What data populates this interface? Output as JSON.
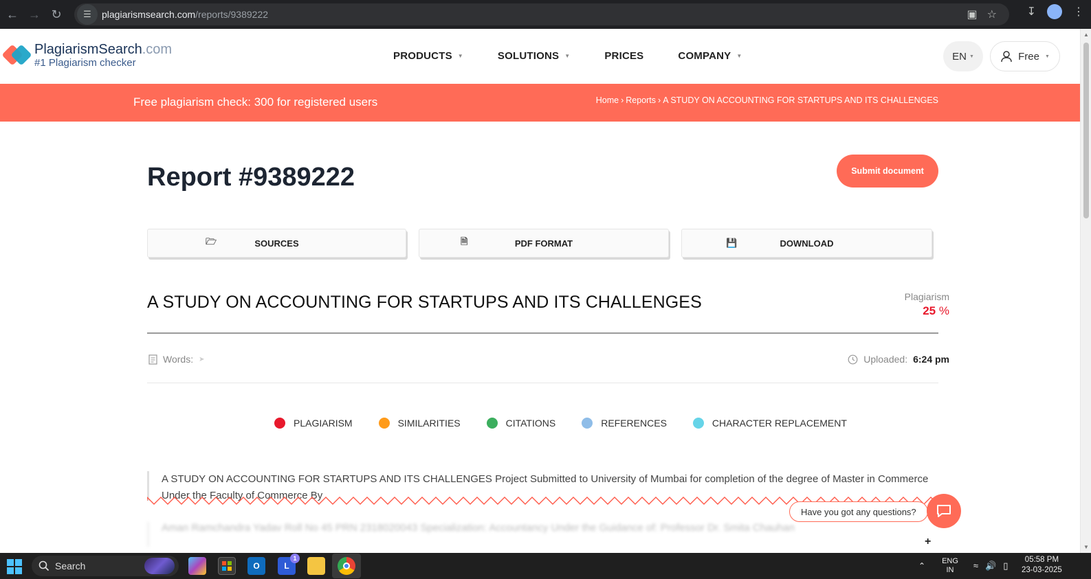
{
  "browser": {
    "url_host": "plagiarismsearch.com",
    "url_path": "/reports/9389222"
  },
  "header": {
    "logo_name": "PlagiarismSearch",
    "logo_domain": ".com",
    "logo_tagline": "#1 Plagiarism checker",
    "nav": [
      {
        "label": "PRODUCTS",
        "dropdown": true
      },
      {
        "label": "SOLUTIONS",
        "dropdown": true
      },
      {
        "label": "PRICES",
        "dropdown": false
      },
      {
        "label": "COMPANY",
        "dropdown": true
      }
    ],
    "language": "EN",
    "account_label": "Free"
  },
  "banner": {
    "promo": "Free plagiarism check: 300 for registered users",
    "breadcrumb": [
      "Home",
      "Reports",
      "A STUDY ON ACCOUNTING FOR STARTUPS AND ITS CHALLENGES"
    ]
  },
  "report": {
    "title": "Report #9389222",
    "submit_label": "Submit document",
    "actions": [
      "SOURCES",
      "PDF FORMAT",
      "DOWNLOAD"
    ],
    "document_title": "A STUDY ON ACCOUNTING FOR STARTUPS AND ITS CHALLENGES",
    "plagiarism_label": "Plagiarism",
    "plagiarism_value": "25",
    "plagiarism_unit": "%",
    "words_label": "Words:",
    "uploaded_label": "Uploaded:",
    "uploaded_value": "6:24 pm"
  },
  "legend": [
    {
      "label": "PLAGIARISM",
      "color": "#e8192c"
    },
    {
      "label": "SIMILARITIES",
      "color": "#ff9b1a"
    },
    {
      "label": "CITATIONS",
      "color": "#3cae5e"
    },
    {
      "label": "REFERENCES",
      "color": "#8fbde8"
    },
    {
      "label": "CHARACTER REPLACEMENT",
      "color": "#66d4e8"
    }
  ],
  "excerpt": {
    "text": "A STUDY ON ACCOUNTING FOR STARTUPS AND ITS CHALLENGES Project Submitted to University of Mumbai for completion of the degree of Master in Commerce Under the Faculty of Commerce By",
    "blurred_text": "Aman Ramchandra Yadav Roll No 45 PRN 2318020043 Specialization: Accountancy Under the Guidance of: Professor Dr. Smita Chauhan"
  },
  "chat": {
    "prompt": "Have you got any questions?"
  },
  "taskbar": {
    "search_label": "Search",
    "badge_count": "1",
    "input_lang_top": "ENG",
    "input_lang_bottom": "IN",
    "time": "05:58 PM",
    "date": "23-03-2025"
  },
  "accent_color": "#ff6b57"
}
